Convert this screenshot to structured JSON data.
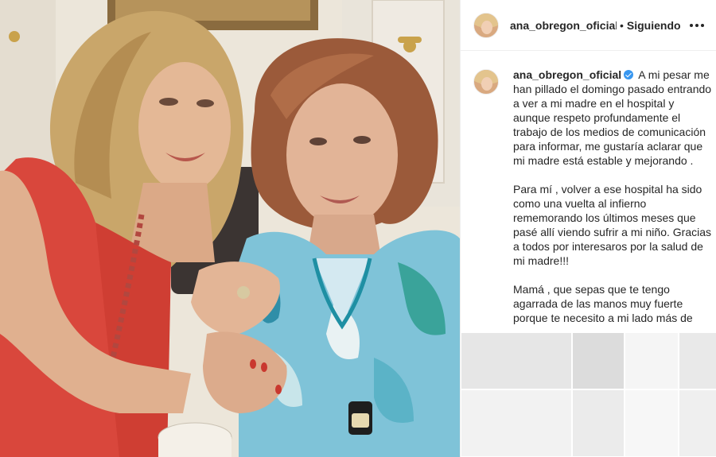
{
  "post": {
    "username": "ana_obregon_oficial",
    "separator": "•",
    "follow_status": "Siguiendo",
    "more_icon": "more-horizontal-icon"
  },
  "caption": {
    "username": "ana_obregon_oficial",
    "verified_icon": "verified-badge-icon",
    "paragraphs": [
      "A mi pesar me han pillado el domingo pasado entrando a ver a mi madre en el hospital y aunque respeto profundamente el trabajo de los medios de comunicación para informar, me gustaría aclarar que mi madre está estable y mejorando .",
      "Para mí , volver a ese hospital ha sido como una vuelta al infierno rememorando los últimos meses que pasé allí viendo sufrir a mi niño. Gracias a todos por interesaros por la salud de mi madre!!!",
      "Mamá , que sepas que te tengo agarrada de las manos muy fuerte porque te necesito a mi lado más de"
    ]
  },
  "colors": {
    "verified": "#3897f0",
    "text": "#262626",
    "border": "#efefef"
  }
}
